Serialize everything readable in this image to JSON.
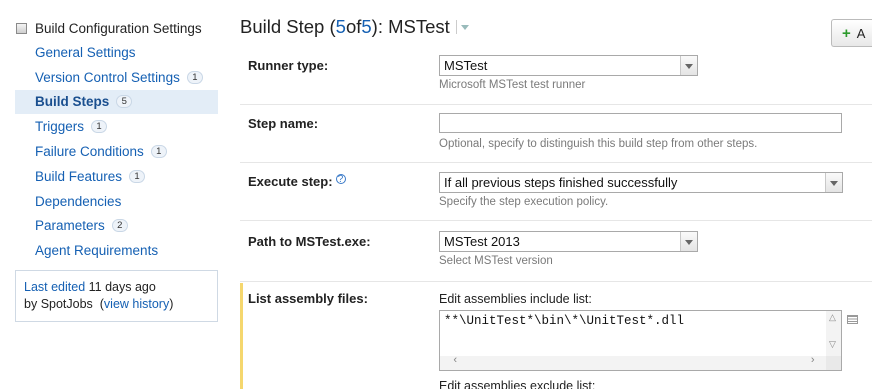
{
  "sidebar": {
    "header": "Build Configuration Settings",
    "items": [
      {
        "label": "General Settings",
        "badge": ""
      },
      {
        "label": "Version Control Settings",
        "badge": "1"
      },
      {
        "label": "Build Steps",
        "badge": "5",
        "active": true
      },
      {
        "label": "Triggers",
        "badge": "1"
      },
      {
        "label": "Failure Conditions",
        "badge": "1"
      },
      {
        "label": "Build Features",
        "badge": "1"
      },
      {
        "label": "Dependencies",
        "badge": ""
      },
      {
        "label": "Parameters",
        "badge": "2"
      },
      {
        "label": "Agent Requirements",
        "badge": ""
      }
    ],
    "last_edited": {
      "prefix": "Last edited",
      "when": "11 days ago",
      "by_prefix": "by",
      "user": "SpotJobs",
      "history_link": "view history"
    }
  },
  "main": {
    "title": {
      "prefix": "Build Step (",
      "current": "5",
      "of": " of ",
      "total": "5",
      "suffix": "): MSTest"
    },
    "add_button": "A",
    "runner_type": {
      "label": "Runner type:",
      "value": "MSTest",
      "note": "Microsoft MSTest test runner"
    },
    "step_name": {
      "label": "Step name:",
      "value": "",
      "note": "Optional, specify to distinguish this build step from other steps."
    },
    "execute_step": {
      "label": "Execute step:",
      "value": "If all previous steps finished successfully",
      "note": "Specify the step execution policy."
    },
    "mstest_path": {
      "label": "Path to MSTest.exe:",
      "value": "MSTest 2013",
      "note": "Select MSTest version"
    },
    "assembly_files": {
      "label": "List assembly files:",
      "include_label": "Edit assemblies include list:",
      "include_value": "**\\UnitTest*\\bin\\*\\UnitTest*.dll",
      "exclude_label": "Edit assemblies exclude list:"
    }
  }
}
